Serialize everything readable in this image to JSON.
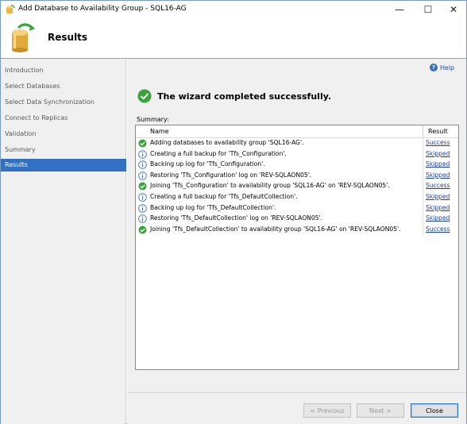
{
  "window": {
    "title": "Add Database to Availability Group - SQL16-AG",
    "controls": {
      "minimize": "—",
      "maximize": "☐",
      "close": "✕"
    }
  },
  "header": {
    "title": "Results"
  },
  "sidebar": {
    "items": [
      {
        "label": "Introduction",
        "active": false
      },
      {
        "label": "Select Databases",
        "active": false
      },
      {
        "label": "Select Data Synchronization",
        "active": false
      },
      {
        "label": "Connect to Replicas",
        "active": false
      },
      {
        "label": "Validation",
        "active": false
      },
      {
        "label": "Summary",
        "active": false
      },
      {
        "label": "Results",
        "active": true
      }
    ]
  },
  "main": {
    "help_label": "Help",
    "status_message": "The wizard completed successfully.",
    "summary_label": "Summary:",
    "table": {
      "columns": [
        "Name",
        "Result"
      ],
      "rows": [
        {
          "icon": "success-icon",
          "name": "Adding databases to availability group 'SQL16-AG'.",
          "result": "Success"
        },
        {
          "icon": "info-icon",
          "name": "Creating a full backup for 'Tfs_Configuration'.",
          "result": "Skipped"
        },
        {
          "icon": "info-icon",
          "name": "Backing up log for 'Tfs_Configuration'.",
          "result": "Skipped"
        },
        {
          "icon": "info-icon",
          "name": "Restoring 'Tfs_Configuration' log on 'REV-SQLAON05'.",
          "result": "Skipped"
        },
        {
          "icon": "success-icon",
          "name": "Joining 'Tfs_Configuration' to availability group 'SQL16-AG' on 'REV-SQLAON05'.",
          "result": "Success"
        },
        {
          "icon": "info-icon",
          "name": "Creating a full backup for 'Tfs_DefaultCollection'.",
          "result": "Skipped"
        },
        {
          "icon": "info-icon",
          "name": "Backing up log for 'Tfs_DefaultCollection'.",
          "result": "Skipped"
        },
        {
          "icon": "info-icon",
          "name": "Restoring 'Tfs_DefaultCollection' log on 'REV-SQLAON05'.",
          "result": "Skipped"
        },
        {
          "icon": "success-icon",
          "name": "Joining 'Tfs_DefaultCollection' to availability group 'SQL16-AG' on 'REV-SQLAON05'.",
          "result": "Success"
        }
      ]
    }
  },
  "footer": {
    "previous_label": "< Previous",
    "next_label": "Next >",
    "close_label": "Close"
  },
  "colors": {
    "sidebar_active": "#3170c2",
    "link": "#1a3fb0",
    "success_green": "#3aa339",
    "info_blue": "#2f6fc8"
  }
}
